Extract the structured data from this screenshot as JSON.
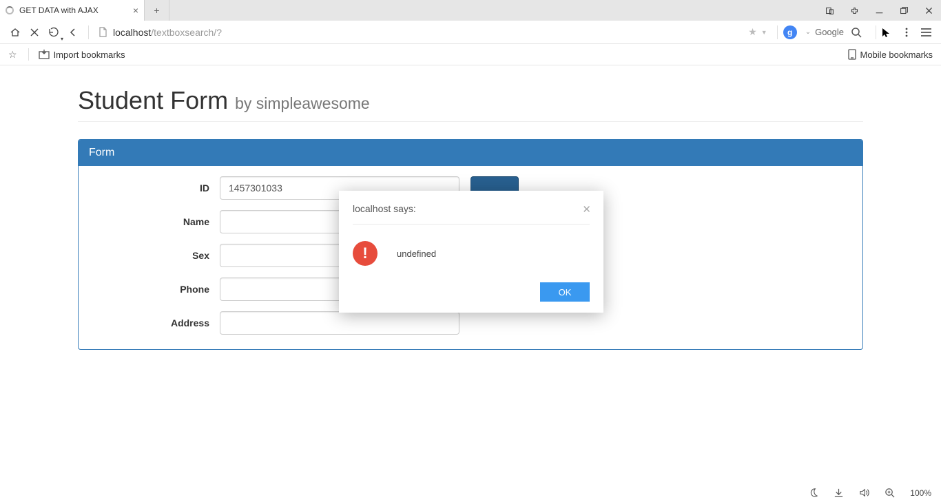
{
  "browser": {
    "tab_title": "GET DATA with AJAX",
    "url_host": "localhost",
    "url_path": "/textboxsearch/?",
    "search_engine": "Google",
    "import_bookmarks": "Import bookmarks",
    "mobile_bookmarks": "Mobile bookmarks",
    "zoom": "100%"
  },
  "page": {
    "title": "Student Form",
    "subtitle": "by simpleawesome",
    "panel_heading": "Form",
    "fields": {
      "id": {
        "label": "ID",
        "value": "1457301033"
      },
      "name": {
        "label": "Name",
        "value": ""
      },
      "sex": {
        "label": "Sex",
        "value": ""
      },
      "phone": {
        "label": "Phone",
        "value": ""
      },
      "address": {
        "label": "Address",
        "value": ""
      }
    }
  },
  "modal": {
    "title": "localhost says:",
    "message": "undefined",
    "ok": "OK"
  }
}
